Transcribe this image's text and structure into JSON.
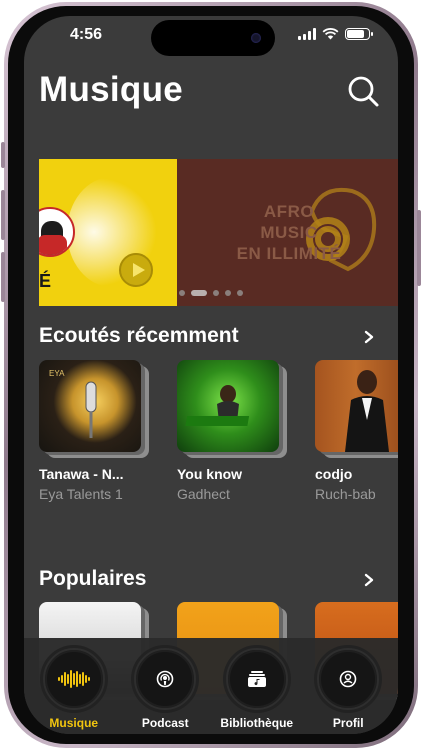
{
  "status_bar": {
    "time": "4:56"
  },
  "header": {
    "title": "Musique"
  },
  "banner": {
    "slide_text": [
      "AFRO",
      "MUSIC",
      "EN ILLIMITÉ"
    ],
    "partial_letter": "É",
    "dots_count": 5,
    "active_dot": 1
  },
  "recent": {
    "title": "Ecoutés récemment",
    "items": [
      {
        "title": "Tanawa - N...",
        "artist": "Eya Talents 1"
      },
      {
        "title": "You know",
        "artist": "Gadhect"
      },
      {
        "title": "codjo",
        "artist": "Ruch-bab"
      }
    ]
  },
  "popular": {
    "title": "Populaires"
  },
  "tabs": [
    {
      "label": "Musique",
      "icon": "waveform-icon",
      "active": true
    },
    {
      "label": "Podcast",
      "icon": "podcast-icon",
      "active": false
    },
    {
      "label": "Bibliothèque",
      "icon": "library-icon",
      "active": false
    },
    {
      "label": "Profil",
      "icon": "profile-icon",
      "active": false
    }
  ],
  "colors": {
    "background": "#3b3b3b",
    "accent": "#f1c40f",
    "banner_yellow": "#f1d10e",
    "banner_brown": "#592b23"
  }
}
